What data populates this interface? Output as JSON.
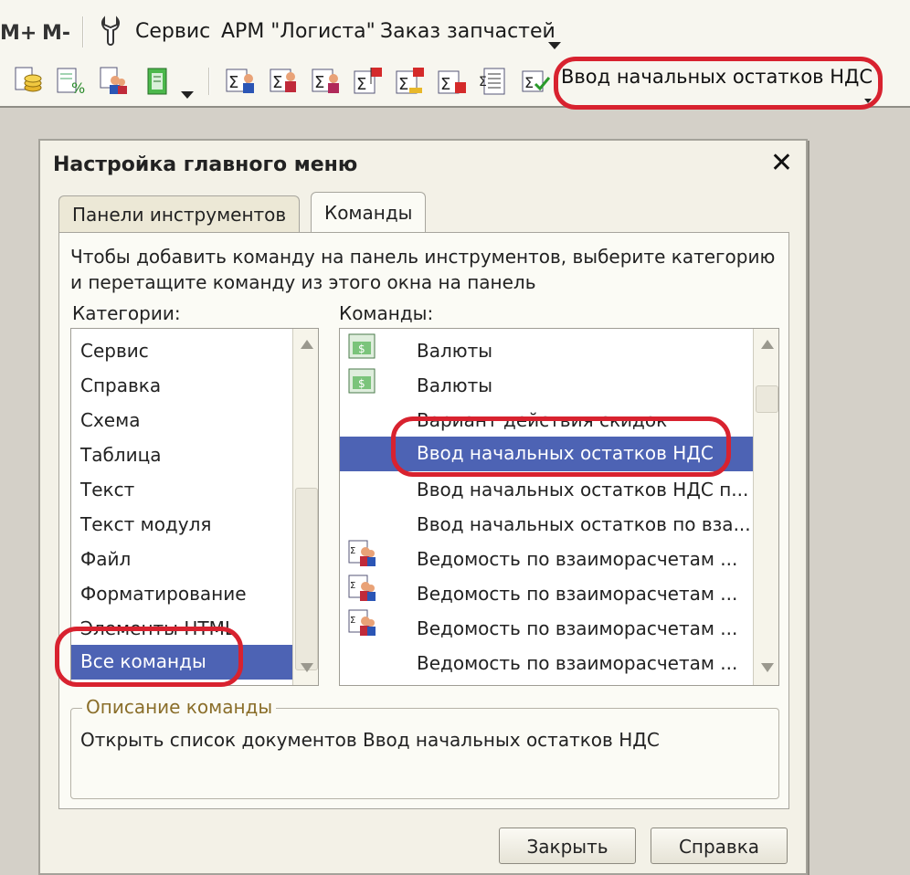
{
  "menubar": {
    "mplus": "M+",
    "mminus": "M-",
    "items": [
      "Сервис",
      "АРМ \"Логиста\"",
      "Заказ запчастей"
    ],
    "icons": [
      "wrench-icon"
    ]
  },
  "toolbar": {
    "highlighted_command": "Ввод начальных остатков НДС",
    "icons": [
      "coins-doc-icon",
      "doc-percent-icon",
      "people-doc-icon",
      "green-book-icon",
      "sigma-doc-icon",
      "sigma-people-icon",
      "sigma-doc-red-icon",
      "sigma-flag-icon",
      "sigma-flag-yellow-icon",
      "sigma-red-icon",
      "sigma-list-icon",
      "sigma-check-icon"
    ]
  },
  "dialog": {
    "title": "Настройка главного меню",
    "close": "✕",
    "tabs": [
      {
        "label": "Панели инструментов",
        "active": false
      },
      {
        "label": "Команды",
        "active": true
      }
    ],
    "hint": "Чтобы добавить команду на панель инструментов, выберите категорию и перетащите команду из этого окна на панель",
    "categories_label": "Категории:",
    "commands_label": "Команды:",
    "categories": [
      "Сервис",
      "Справка",
      "Схема",
      "Таблица",
      "Текст",
      "Текст модуля",
      "Файл",
      "Форматирование",
      "Элементы HTML",
      "Все команды"
    ],
    "selected_category": "Все команды",
    "commands": [
      {
        "label": "Валюты",
        "icon": "currency-icon"
      },
      {
        "label": "Валюты",
        "icon": "currency-icon"
      },
      {
        "label": "Вариант действия скидок",
        "icon": ""
      },
      {
        "label": "Ввод начальных остатков НДС",
        "icon": "",
        "selected": true
      },
      {
        "label": "Ввод начальных остатков НДС п...",
        "icon": ""
      },
      {
        "label": "Ввод начальных остатков по вза...",
        "icon": ""
      },
      {
        "label": "Ведомость по взаиморасчетам ...",
        "icon": "people-report-icon"
      },
      {
        "label": "Ведомость по взаиморасчетам ...",
        "icon": "people-report-icon"
      },
      {
        "label": "Ведомость по взаиморасчетам ...",
        "icon": "people-report-icon"
      },
      {
        "label": "Ведомость по взаиморасчетам ...",
        "icon": ""
      }
    ],
    "description_legend": "Описание команды",
    "description_text": "Открыть список документов Ввод начальных остатков НДС",
    "buttons": {
      "close": "Закрыть",
      "help": "Справка"
    }
  },
  "colors": {
    "selection": "#4d63b4",
    "highlight_oval": "#d8222f",
    "window_bg": "#d4d0c8"
  }
}
